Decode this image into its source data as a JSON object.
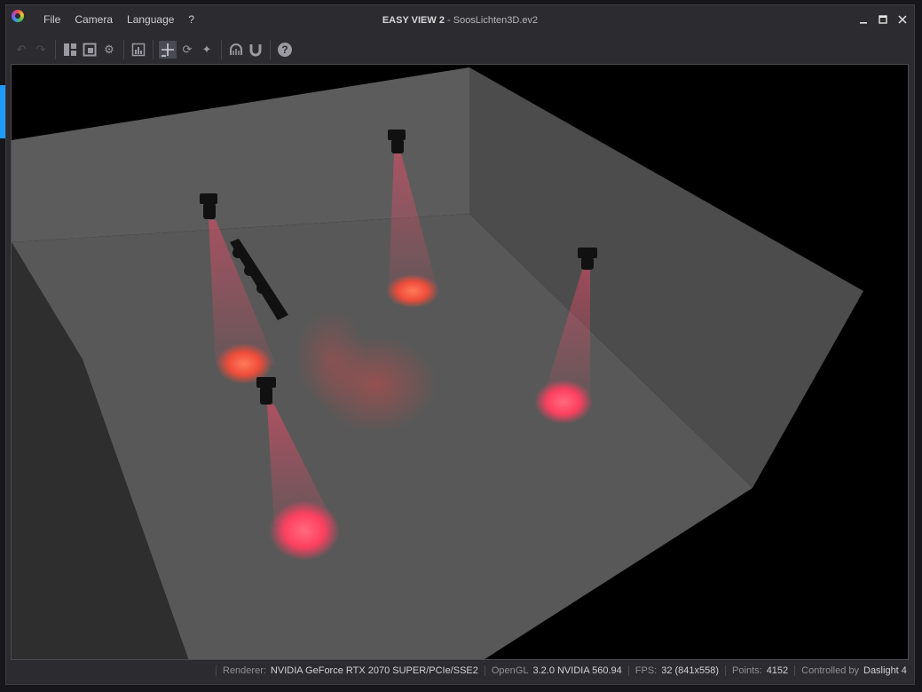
{
  "window": {
    "app_name": "EASY VIEW 2",
    "title_separator": " - ",
    "file_name": "SoosLichten3D.ev2"
  },
  "menu": {
    "items": [
      "File",
      "Camera",
      "Language",
      "?"
    ]
  },
  "toolbar": {
    "icons": [
      "undo-icon",
      "redo-icon",
      "layout-icon",
      "window-icon",
      "settings-icon",
      "stats-icon",
      "move-icon",
      "rotate-icon",
      "target-icon",
      "fixture-icon",
      "magnet-icon",
      "help-icon"
    ]
  },
  "status": {
    "renderer_label": "Renderer:",
    "renderer_value": "NVIDIA GeForce RTX 2070 SUPER/PCIe/SSE2",
    "opengl_label": "OpenGL",
    "opengl_value": "3.2.0 NVIDIA 560.94",
    "fps_label": "FPS:",
    "fps_value": "32 (841x558)",
    "points_label": "Points:",
    "points_value": "4152",
    "controlled_label": "Controlled by",
    "controlled_value": "Daslight 4"
  },
  "colors": {
    "beam": "#ff4060",
    "window_bg": "#2b2b30",
    "accent": "#1f9bff"
  }
}
